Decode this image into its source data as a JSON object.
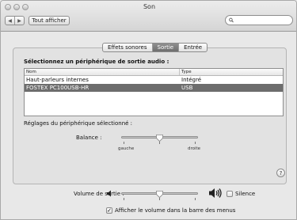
{
  "window": {
    "title": "Son"
  },
  "toolbar": {
    "back_glyph": "◀",
    "forward_glyph": "▶",
    "show_all_label": "Tout afficher",
    "search_placeholder": "",
    "search_icon": "magnifier-icon"
  },
  "tabs": [
    {
      "label": "Effets sonores",
      "active": false
    },
    {
      "label": "Sortie",
      "active": true
    },
    {
      "label": "Entrée",
      "active": false
    }
  ],
  "output": {
    "heading": "Sélectionnez un périphérique de sortie audio :",
    "columns": {
      "name": "Nom",
      "type": "Type"
    },
    "devices": [
      {
        "name": "Haut-parleurs internes",
        "type": "Intégré",
        "selected": false
      },
      {
        "name": "FOSTEX PC100USB-HR",
        "type": "USB",
        "selected": true
      }
    ],
    "settings_label": "Réglages du périphérique sélectionné :",
    "balance": {
      "label": "Balance :",
      "left_label": "gauche",
      "right_label": "droite",
      "value": 0.5
    }
  },
  "help": {
    "label": "?"
  },
  "bottom": {
    "volume_label": "Volume de sortie :",
    "volume_value": 0.5,
    "mute_label": "Silence",
    "mute_checked": false,
    "menubar_label": "Afficher le volume dans la barre des menus",
    "menubar_checked": true,
    "check_glyph": "✓"
  }
}
